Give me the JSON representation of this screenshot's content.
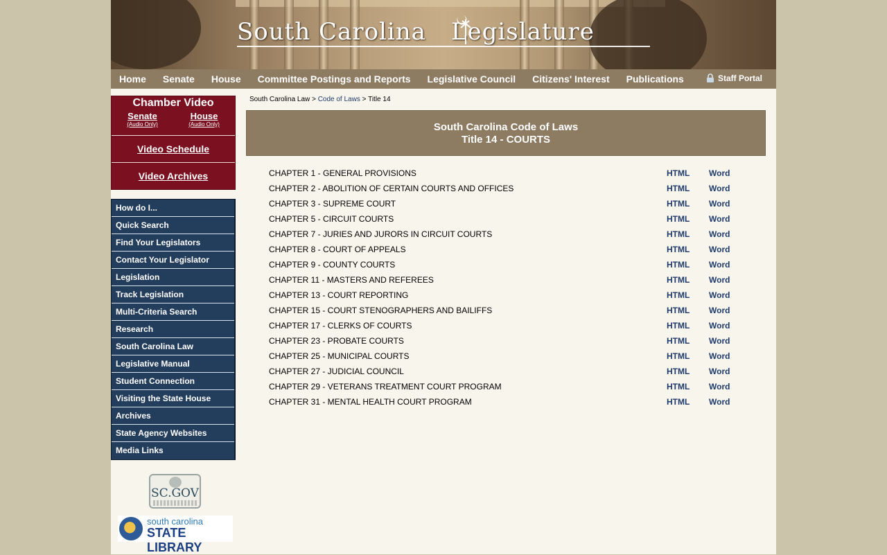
{
  "header": {
    "title_left": "South Carolina",
    "title_right": "Legislature"
  },
  "topnav": {
    "items": [
      "Home",
      "Senate",
      "House",
      "Committee Postings and Reports",
      "Legislative Council",
      "Citizens' Interest",
      "Publications"
    ],
    "staff_portal": "Staff Portal"
  },
  "chamber": {
    "title": "Chamber Video",
    "senate": "Senate",
    "senate_sub": "(Audio Only)",
    "house": "House",
    "house_sub": "(Audio Only)",
    "schedule": "Video Schedule",
    "archives": "Video Archives"
  },
  "leftnav": {
    "items": [
      "How do I...",
      "Quick Search",
      "Find Your Legislators",
      "Contact Your Legislator",
      "Legislation",
      "Track Legislation",
      "Multi-Criteria Search",
      "Research",
      "South Carolina Law",
      "Legislative Manual",
      "Student Connection",
      "Visiting the State House",
      "Archives",
      "State Agency Websites",
      "Media Links"
    ]
  },
  "logos": {
    "scgov": "SC.GOV",
    "statelib_line1": "south carolina",
    "statelib_line2": "STATE LIBRARY"
  },
  "breadcrumb": {
    "root": "South Carolina Law",
    "sep": ">",
    "code": "Code of Laws",
    "current": "Title 14"
  },
  "main": {
    "title_line1": "South Carolina Code of Laws",
    "title_line2": "Title 14 - COURTS",
    "html_label": "HTML",
    "word_label": "Word",
    "chapters": [
      "CHAPTER 1 - GENERAL PROVISIONS",
      "CHAPTER 2 - ABOLITION OF CERTAIN COURTS AND OFFICES",
      "CHAPTER 3 - SUPREME COURT",
      "CHAPTER 5 - CIRCUIT COURTS",
      "CHAPTER 7 - JURIES AND JURORS IN CIRCUIT COURTS",
      "CHAPTER 8 - COURT OF APPEALS",
      "CHAPTER 9 - COUNTY COURTS",
      "CHAPTER 11 - MASTERS AND REFEREES",
      "CHAPTER 13 - COURT REPORTING",
      "CHAPTER 15 - COURT STENOGRAPHERS AND BAILIFFS",
      "CHAPTER 17 - CLERKS OF COURTS",
      "CHAPTER 23 - PROBATE COURTS",
      "CHAPTER 25 - MUNICIPAL COURTS",
      "CHAPTER 27 - JUDICIAL COUNCIL",
      "CHAPTER 29 - VETERANS TREATMENT COURT PROGRAM",
      "CHAPTER 31 - MENTAL HEALTH COURT PROGRAM"
    ]
  }
}
